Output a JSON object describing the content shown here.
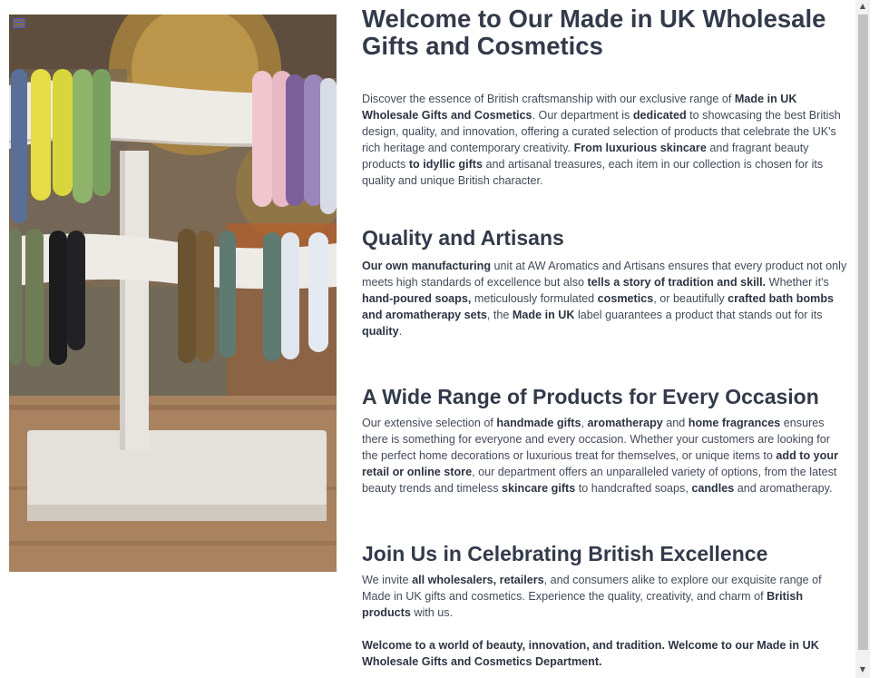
{
  "image": {
    "alt": "Gemstone bead bracelets displayed on a whitewashed wooden T-bar stand"
  },
  "header": {
    "title": "Welcome to Our Made in UK Wholesale Gifts and Cosmetics"
  },
  "intro": {
    "t1": "Discover the essence of British craftsmanship with our exclusive range of ",
    "b1": "Made in UK Wholesale Gifts and Cosmetics",
    "t2": ". Our department is ",
    "b2": "dedicated",
    "t3": " to showcasing the best British design, quality, and innovation, offering a curated selection of products that celebrate the UK's rich heritage and contemporary creativity. ",
    "b3": "From luxurious skincare",
    "t4": " and fragrant beauty products ",
    "b4": "to idyllic gifts",
    "t5": " and artisanal treasures, each item in our collection is chosen for its quality and unique British character."
  },
  "quality": {
    "heading": "Quality and Artisans",
    "b1": "Our own manufacturing",
    "t1": " unit at AW Aromatics and Artisans ensures that every product not only meets high standards of excellence but also ",
    "b2": "tells a story of tradition and skill.",
    "t2": " Whether it's ",
    "b3": "hand-poured soaps,",
    "t3": " meticulously formulated ",
    "b4": "cosmetics",
    "t4": ", or beautifully ",
    "b5": "crafted bath bombs and aromatherapy sets",
    "t5": ", the ",
    "b6": "Made in UK",
    "t6": " label guarantees a product that stands out for its ",
    "b7": "quality",
    "t7": "."
  },
  "range": {
    "heading": "A Wide Range of Products for Every Occasion",
    "t1": "Our extensive selection of ",
    "b1": "handmade gifts",
    "t2": ", ",
    "b2": "aromatherapy",
    "t3": " and ",
    "b3": "home fragrances",
    "t4": " ensures there is something for everyone and every occasion. Whether your customers are looking for the perfect home decorations or luxurious treat for themselves, or unique items to ",
    "b4": "add to your retail or online store",
    "t5": ", our department offers an unparalleled variety of options, from the latest beauty trends and timeless ",
    "b5": "skincare gifts",
    "t6": " to handcrafted soaps, ",
    "b6": "candles",
    "t7": " and aromatherapy."
  },
  "join": {
    "heading": "Join Us in Celebrating British Excellence",
    "t1": "We invite ",
    "b1": "all wholesalers, retailers",
    "t2": ", and consumers alike to explore our exquisite range of Made in UK gifts and cosmetics. Experience the quality, creativity, and charm of ",
    "b2": "British products",
    "t3": " with us."
  },
  "closing": {
    "text": "Welcome to a world of beauty, innovation, and tradition. Welcome to our Made in UK Wholesale Gifts and Cosmetics Department."
  },
  "scrollbar": {
    "up_glyph": "▲",
    "down_glyph": "▼"
  },
  "icons": {
    "photo_badge": "image-badge-icon"
  },
  "colors": {
    "heading": "#333a4a",
    "body": "#424a59",
    "accent_badge": "#4a57d6"
  }
}
